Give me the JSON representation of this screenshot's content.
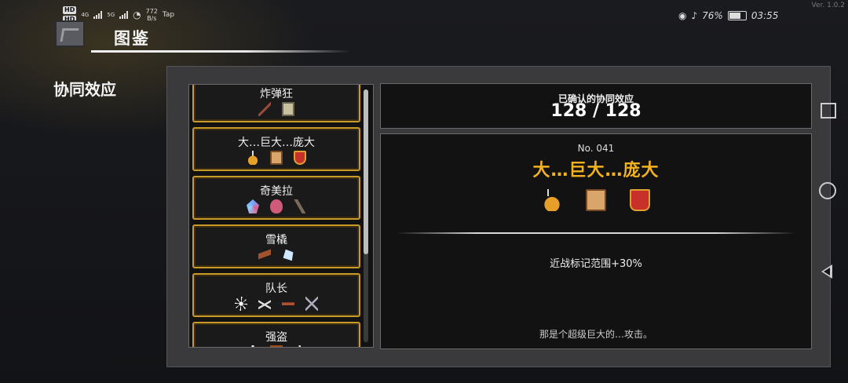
{
  "status_bar": {
    "hd1": "HD",
    "hd2": "HD",
    "signal1": "4G",
    "signal2": "5G",
    "speed_value": "772",
    "speed_unit": "B/s",
    "tap": "Tap",
    "battery": "76%",
    "time": "03:55",
    "battery_level": 0.76
  },
  "version": "Ver. 1.0.2",
  "header": {
    "title": "图鉴"
  },
  "page_subtitle": "协同效应",
  "synergy_list": [
    {
      "name": "炸弹狂",
      "icons": [
        "branch-icon",
        "scroll-icon"
      ]
    },
    {
      "name": "大…巨大…庞大",
      "icons": [
        "flask-icon",
        "book-icon",
        "shield-icon"
      ]
    },
    {
      "name": "奇美拉",
      "icons": [
        "crystal-icon",
        "egg-icon",
        "lizard-icon"
      ]
    },
    {
      "name": "雪橇",
      "icons": [
        "plank-icon",
        "ice-icon"
      ]
    },
    {
      "name": "队长",
      "icons": [
        "star-icon",
        "claw-icon",
        "gun-icon",
        "swords-icon"
      ]
    },
    {
      "name": "强盗",
      "icons": [
        "dagger-icon",
        "chest-icon",
        "hook-icon"
      ]
    }
  ],
  "confirmed": {
    "label": "已确认的协同效应",
    "value": "128 / 128"
  },
  "detail": {
    "number": "No. 041",
    "name": "大…巨大…庞大",
    "icons": [
      "flask-icon",
      "book-icon",
      "shield-icon"
    ],
    "effect": "近战标记范围+30%",
    "flavor": "那是个超级巨大的…攻击。"
  },
  "colors": {
    "accent_gold": "#f2b21e",
    "item_border": "#c89a2a"
  }
}
